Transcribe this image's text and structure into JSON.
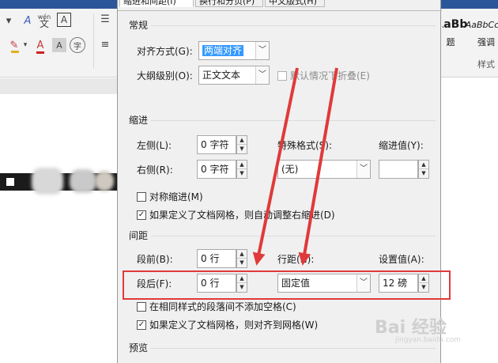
{
  "dialog": {
    "tabs": [
      "缩进和间距(I)",
      "换行和分页(P)",
      "中文版式(H)"
    ],
    "general": {
      "title": "常规",
      "alignment_label": "对齐方式(G):",
      "alignment_value": "两端对齐",
      "outline_label": "大纲级别(O):",
      "outline_value": "正文文本",
      "collapse_label": "默认情况下折叠(E)"
    },
    "indent": {
      "title": "缩进",
      "left_label": "左侧(L):",
      "left_value": "0 字符",
      "right_label": "右侧(R):",
      "right_value": "0 字符",
      "special_label": "特殊格式(S):",
      "special_value": "(无)",
      "by_label": "缩进值(Y):",
      "by_value": "",
      "mirror_label": "对称缩进(M)",
      "auto_adjust_label": "如果定义了文档网格，则自动调整右缩进(D)"
    },
    "spacing": {
      "title": "间距",
      "before_label": "段前(B):",
      "before_value": "0 行",
      "after_label": "段后(F):",
      "after_value": "0 行",
      "line_label": "行距(N):",
      "line_value": "固定值",
      "at_label": "设置值(A):",
      "at_value": "12 磅",
      "no_space_label": "在相同样式的段落间不添加空格(C)",
      "snap_grid_label": "如果定义了文档网格，则对齐到网格(W)"
    },
    "preview_title": "预览"
  },
  "ribbon": {
    "style_sample_1": "AaBbC",
    "style_sample_2": "AaBbCc",
    "style_caption_1": "题",
    "style_caption_2": "强调",
    "styles_group": "样式",
    "wen_label": "wén",
    "wen_char": "文",
    "zi_char": "字",
    "a_char": "A"
  },
  "watermark": {
    "text": "Bai 经验",
    "sub": "jingyan.baidu.com"
  },
  "colors": {
    "highlight": "#e03a3a",
    "arrow": "#e03a3a",
    "selection": "#3399ff",
    "word_blue": "#2b579a"
  }
}
